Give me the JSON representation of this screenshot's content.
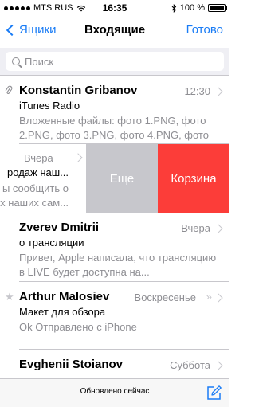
{
  "statusbar": {
    "carrier": "MTS RUS",
    "time": "16:35",
    "battery": "100 %"
  },
  "nav": {
    "back_label": "Ящики",
    "title": "Входящие",
    "done_label": "Готово"
  },
  "search": {
    "placeholder": "Поиск"
  },
  "messages": [
    {
      "sender": "Konstantin Gribanov",
      "date": "12:30",
      "subject": "iTunes Radio",
      "preview": "Вложенные файлы: фото 1.PNG, фото 2.PNG, фото 3.PNG, фото 4.PNG, фото"
    },
    {
      "date": "Вчера",
      "subject": "родаж наш...",
      "preview_line1": "ы сообщить о",
      "preview_line2": "ных наших сам..."
    },
    {
      "sender": "Zverev Dmitrii",
      "date": "Вчера",
      "subject": "о трансляции",
      "preview": "Привет, Apple написала, что трансляцию в LIVE будет доступна на..."
    },
    {
      "sender": "Arthur Malosiev",
      "date": "Воскресенье",
      "subject": "Макет для обзора",
      "preview": "Ok Отправлено с iPhone"
    },
    {
      "sender": "Evghenii Stoianov",
      "date": "Суббота"
    }
  ],
  "swipe_actions": {
    "more_label": "Еще",
    "trash_label": "Корзина"
  },
  "toolbar": {
    "status": "Обновлено сейчас"
  },
  "colors": {
    "accent": "#1a7cf5",
    "trash": "#fc3d39",
    "more": "#c7c7cc"
  }
}
